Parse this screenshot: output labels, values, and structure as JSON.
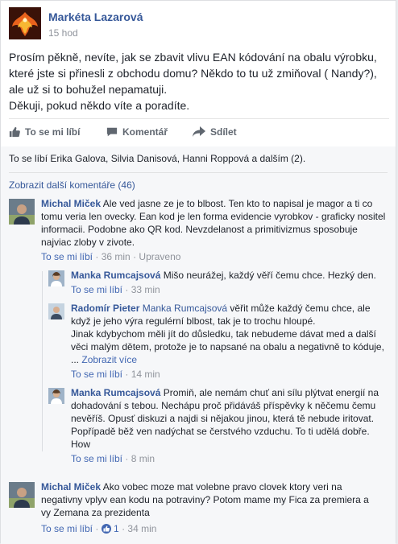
{
  "post": {
    "author": "Markéta Lazarová",
    "time": "15 hod",
    "text": "Prosím pěkně, nevíte, jak se zbavit vlivu EAN kódování na obalu výrobku, které jste si přinesli z obchodu domu? Někdo to tu už zmiňoval ( Nandy?), ale už si to bohužel nepamatuji.\nDěkuji, pokud někdo víte a poradíte."
  },
  "actions": {
    "like": "To se mi líbí",
    "comment": "Komentář",
    "share": "Sdílet"
  },
  "likes_line": "To se líbí Erika Galova, Silvia Danisová, Hanni Roppová a dalším (2).",
  "more_comments": "Zobrazit další komentáře (46)",
  "comments": [
    {
      "author": "Michal Miček",
      "text": "Ale ved jasne ze je to blbost. Ten kto to napisal je magor a ti co tomu veria len ovecky. Ean kod je len forma evidencie vyrobkov - graficky nositel informacii. Podobne ako QR kod. Nevzdelanost a primitivizmus sposobuje najviac zloby v zivote.",
      "like": "To se mi líbí",
      "time": "36 min",
      "edited": "Upraveno"
    },
    {
      "author": "Manka Rumcajsová",
      "text": "Mišo neurážej, každý věří čemu chce. Hezký den.",
      "like": "To se mi líbí",
      "time": "33 min"
    },
    {
      "author": "Radomír Pieter",
      "tag": "Manka Rumcajsová",
      "text": "věřit může každý čemu chce, ale když je jeho výra regulérní blbost, tak je to trochu hloupé.\nJinak kdybychom měli jít do důsledku, tak nebudeme dávat med a další věci malým dětem, protože je to napsané na obalu a negativně to kóduje, ...",
      "see_more": "Zobrazit více",
      "like": "To se mi líbí",
      "time": "14 min"
    },
    {
      "author": "Manka Rumcajsová",
      "text": "Promiň, ale nemám chuť ani sílu plýtvat energií na dohadování s tebou. Nechápu proč přidáváš příspěvky k něčemu čemu nevěříš. Opusť diskuzi a najdi si nějakou jinou, která tě nebude iritovat. Popřípadě běž ven nadýchat se čerstvého vzduchu. To ti udělá dobře. How",
      "like": "To se mi líbí",
      "time": "8 min"
    },
    {
      "author": "Michal Miček",
      "text": "Ako vobec moze mat volebne pravo clovek ktory veri na negativny vplyv ean kodu na potraviny? Potom mame my Fica za premiera a vy Zemana za prezidenta",
      "like": "To se mi líbí",
      "reactions": "1",
      "time": "34 min"
    }
  ],
  "sep": " · "
}
